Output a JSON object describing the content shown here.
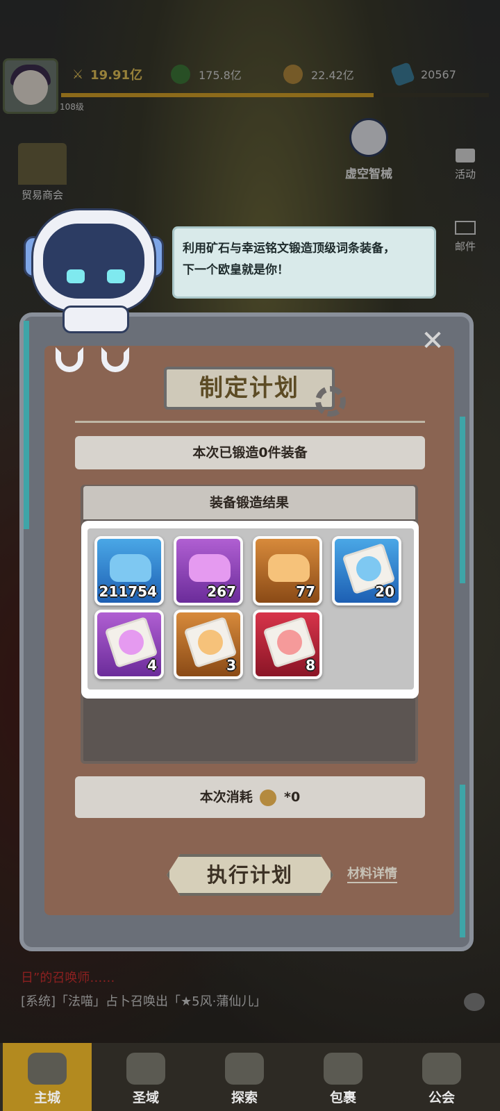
{
  "header": {
    "level": "108级",
    "power": "19.91亿",
    "res1": "175.8亿",
    "res2": "22.42亿",
    "res3": "20567"
  },
  "left_icons": {
    "trade": "贸易商会"
  },
  "right_buttons": {
    "activity": "活动",
    "mail": "邮件"
  },
  "npc": {
    "name": "虚空智械"
  },
  "bubble": {
    "line1": "利用矿石与幸运铭文锻造顶级词条装备，",
    "line2": "下一个欧皇就是你！"
  },
  "dialog": {
    "title": "制定计划",
    "forged_info": "本次已锻造0件装备",
    "result_title": "装备锻造结果",
    "items": [
      {
        "kind": "ore",
        "rarity": "blue",
        "count": "211754"
      },
      {
        "kind": "ore",
        "rarity": "purple",
        "count": "267"
      },
      {
        "kind": "ore",
        "rarity": "orange",
        "count": "77"
      },
      {
        "kind": "scroll",
        "rarity": "blue",
        "count": "20"
      },
      {
        "kind": "scroll",
        "rarity": "purple",
        "count": "4"
      },
      {
        "kind": "scroll",
        "rarity": "orange",
        "count": "3"
      },
      {
        "kind": "scroll",
        "rarity": "red",
        "count": "8"
      }
    ],
    "cost_label": "本次消耗",
    "cost_value": "*0",
    "execute_button": "执行计划",
    "details_link": "材料详情"
  },
  "chat": {
    "line1": "日”的召唤师……",
    "line2_prefix": "[系统]「法喵」占卜召唤出「★5风·蒲仙儿」"
  },
  "nav": [
    {
      "label": "主城",
      "active": true
    },
    {
      "label": "圣域",
      "active": false
    },
    {
      "label": "探索",
      "active": false
    },
    {
      "label": "包裹",
      "active": false
    },
    {
      "label": "公会",
      "active": false
    }
  ],
  "colors": {
    "gold": "#d8a429",
    "panel": "#8a6452",
    "highlight": "#ffffff",
    "blue": "#1d5fb3",
    "purple": "#6b2c9a",
    "orange": "#8a4a16",
    "red": "#8a1526"
  }
}
